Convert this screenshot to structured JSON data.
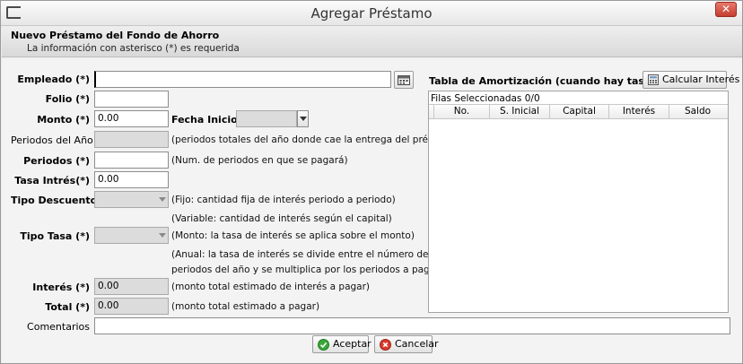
{
  "window": {
    "title": "Agregar Préstamo",
    "close_label": "✕"
  },
  "header": {
    "title": "Nuevo Préstamo del Fondo de Ahorro",
    "subtitle": "La información con asterisco (*) es requerida"
  },
  "form": {
    "empleado_label": "Empleado (*)",
    "empleado_value": "",
    "folio_label": "Folio (*)",
    "folio_value": "",
    "monto_label": "Monto (*)",
    "monto_value": "0.00",
    "fecha_inicio_label": "Fecha Inicio (*)",
    "fecha_inicio_value": "",
    "periodos_anio_label": "Periodos del Año",
    "periodos_anio_value": "",
    "periodos_anio_hint": "(periodos totales del año donde cae la entrega del préstamo)",
    "periodos_label": "Periodos (*)",
    "periodos_value": "",
    "periodos_hint": "(Num. de periodos en que se pagará)",
    "tasa_label": "Tasa Intrés(*)",
    "tasa_value": "0.00",
    "tipo_descuento_label": "Tipo Descuento (*)",
    "tipo_descuento_value": "",
    "tipo_descuento_hint1": "(Fijo: cantidad fija de interés periodo a periodo)",
    "tipo_descuento_hint2": "(Variable: cantidad de interés según el capital)",
    "tipo_tasa_label": "Tipo Tasa (*)",
    "tipo_tasa_value": "",
    "tipo_tasa_hint1": "(Monto: la tasa de interés se aplica sobre el monto)",
    "tipo_tasa_hint2": "(Anual: la tasa de interés se divide entre el número de",
    "tipo_tasa_hint3": "periodos del año y se multiplica por los periodos a pagar)",
    "interes_label": "Interés (*)",
    "interes_value": "0.00",
    "interes_hint": "(monto total estimado de interés a pagar)",
    "total_label": "Total (*)",
    "total_value": "0.00",
    "total_hint": "(monto total estimado a pagar)",
    "comentarios_label": "Comentarios",
    "comentarios_value": ""
  },
  "amortization": {
    "title": "Tabla de Amortización (cuando hay tasa de interés)",
    "calc_button": "Calcular Interés",
    "selected_rows": "Filas Seleccionadas  0/0",
    "columns": [
      "No.",
      "S. Inicial",
      "Capital",
      "Interés",
      "Saldo"
    ]
  },
  "actions": {
    "accept": "Aceptar",
    "cancel": "Cancelar"
  },
  "colors": {
    "accept_icon": "#3aa83a",
    "cancel_icon": "#d83a2c",
    "close_button": "#c94a3c"
  }
}
